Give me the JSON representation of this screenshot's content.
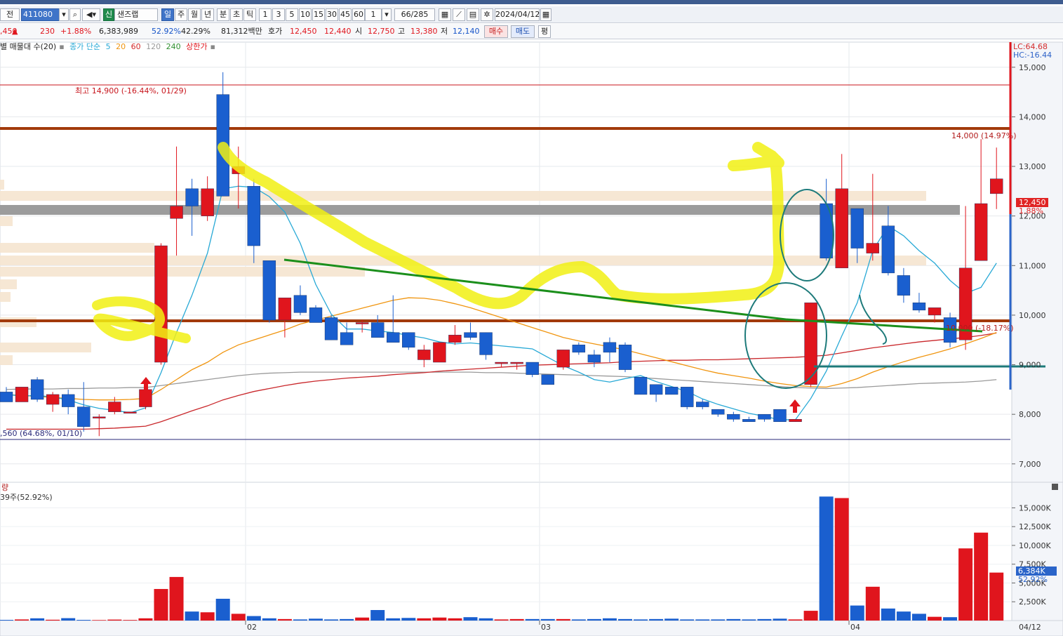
{
  "toolbar": {
    "prev_label": "전",
    "code_value": "411080",
    "sin_badge": "신",
    "stock_name": "샌즈랩",
    "periods": [
      "일",
      "주",
      "월",
      "년",
      "분",
      "초",
      "틱"
    ],
    "intervals": [
      "1",
      "3",
      "5",
      "10",
      "15",
      "30",
      "45",
      "60"
    ],
    "count_value": "1",
    "page_counter": "66/285",
    "date_value": "2024/04/12"
  },
  "quote": {
    "prefix": ",450",
    "arrow": "▲",
    "change": "230",
    "change_pct": "+1.88%",
    "volume": "6,383,989",
    "vol_ratio": "52.92%",
    "turnover_pct": "42.29%",
    "amount": "81,312백만",
    "hoga_label": "호가",
    "ask": "12,450",
    "bid": "12,440",
    "open_label": "시",
    "open": "12,750",
    "high_label": "고",
    "high": "13,380",
    "low_label": "저",
    "low": "12,140",
    "buy_label": "매수",
    "sell_label": "매도",
    "eval_label": "평"
  },
  "legend": {
    "volume_profile": "별 매물대 수(20)",
    "ma_title": "종가 단순",
    "ma_periods": [
      "5",
      "20",
      "60",
      "120",
      "240"
    ],
    "ma_colors": [
      "#28a9d6",
      "#f0950f",
      "#d32a2a",
      "#9a9a9a",
      "#2f8f2f"
    ],
    "limit_label": "상한가"
  },
  "price_panel": {
    "lc_label": "LC:64.68",
    "hc_label": "HC:-16.44",
    "high_annotation": "최고 14,900 (-16.44%, 01/29)",
    "low_annotation": ",560 (64.68%, 01/10)",
    "level_annotation": "10,000 (-18.17%)",
    "top_annotation": "14,000 (14.97%)",
    "current_price": "12,450",
    "current_pct": "1.88%",
    "y_ticks": [
      "15,000",
      "14,000",
      "13,000",
      "12,000",
      "11,000",
      "10,000",
      "9,000",
      "8,000",
      "7,000"
    ]
  },
  "volume_panel": {
    "header_label": "량",
    "sub_label": "39주(52.92%)",
    "y_ticks": [
      "15,000K",
      "12,500K",
      "10,000K",
      "7,500K",
      "5,000K",
      "2,500K"
    ],
    "current_volume": "6,384K",
    "current_pct": "52.92%"
  },
  "x_axis": {
    "month_labels": [
      "02",
      "03",
      "04"
    ],
    "last_date": "04/12"
  },
  "chart_data": {
    "type": "candlestick",
    "candles": [
      {
        "o": 8450,
        "h": 8550,
        "l": 8250,
        "c": 8250
      },
      {
        "o": 8250,
        "h": 8550,
        "l": 8250,
        "c": 8550
      },
      {
        "o": 8700,
        "h": 8750,
        "l": 8250,
        "c": 8300
      },
      {
        "o": 8200,
        "h": 8450,
        "l": 8050,
        "c": 8400
      },
      {
        "o": 8400,
        "h": 8500,
        "l": 8000,
        "c": 8150
      },
      {
        "o": 8150,
        "h": 8650,
        "l": 7650,
        "c": 7750
      },
      {
        "o": 7950,
        "h": 8000,
        "l": 7560,
        "c": 7950
      },
      {
        "o": 8050,
        "h": 8350,
        "l": 8000,
        "c": 8250
      },
      {
        "o": 8050,
        "h": 8050,
        "l": 8050,
        "c": 8050
      },
      {
        "o": 8150,
        "h": 8550,
        "l": 8100,
        "c": 8500
      },
      {
        "o": 9050,
        "h": 11450,
        "l": 9000,
        "c": 11400
      },
      {
        "o": 11950,
        "h": 13400,
        "l": 11200,
        "c": 12200
      },
      {
        "o": 12550,
        "h": 12750,
        "l": 11600,
        "c": 12200
      },
      {
        "o": 12000,
        "h": 12800,
        "l": 11900,
        "c": 12550
      },
      {
        "o": 14450,
        "h": 14900,
        "l": 12400,
        "c": 12400
      },
      {
        "o": 12850,
        "h": 13400,
        "l": 12150,
        "c": 13000
      },
      {
        "o": 12600,
        "h": 12750,
        "l": 11050,
        "c": 11400
      },
      {
        "o": 11100,
        "h": 11100,
        "l": 9850,
        "c": 9900
      },
      {
        "o": 9900,
        "h": 10350,
        "l": 9550,
        "c": 10350
      },
      {
        "o": 10400,
        "h": 10600,
        "l": 10000,
        "c": 10050
      },
      {
        "o": 10150,
        "h": 10200,
        "l": 9850,
        "c": 9850
      },
      {
        "o": 9950,
        "h": 10000,
        "l": 9500,
        "c": 9500
      },
      {
        "o": 9650,
        "h": 9850,
        "l": 9400,
        "c": 9400
      },
      {
        "o": 9850,
        "h": 9900,
        "l": 9650,
        "c": 9850
      },
      {
        "o": 9850,
        "h": 10000,
        "l": 9550,
        "c": 9550
      },
      {
        "o": 9650,
        "h": 10400,
        "l": 9500,
        "c": 9450
      },
      {
        "o": 9650,
        "h": 9650,
        "l": 9300,
        "c": 9350
      },
      {
        "o": 9100,
        "h": 9400,
        "l": 8950,
        "c": 9300
      },
      {
        "o": 9050,
        "h": 9450,
        "l": 9050,
        "c": 9450
      },
      {
        "o": 9450,
        "h": 9800,
        "l": 9400,
        "c": 9600
      },
      {
        "o": 9650,
        "h": 9850,
        "l": 9500,
        "c": 9550
      },
      {
        "o": 9650,
        "h": 9650,
        "l": 9100,
        "c": 9200
      },
      {
        "o": 9050,
        "h": 9050,
        "l": 8950,
        "c": 9050
      },
      {
        "o": 9050,
        "h": 9050,
        "l": 8900,
        "c": 9050
      },
      {
        "o": 9050,
        "h": 9050,
        "l": 8750,
        "c": 8800
      },
      {
        "o": 8800,
        "h": 8800,
        "l": 8600,
        "c": 8600
      },
      {
        "o": 8950,
        "h": 9300,
        "l": 8900,
        "c": 9300
      },
      {
        "o": 9400,
        "h": 9450,
        "l": 9200,
        "c": 9250
      },
      {
        "o": 9200,
        "h": 9300,
        "l": 8950,
        "c": 9050
      },
      {
        "o": 9450,
        "h": 9550,
        "l": 9050,
        "c": 9250
      },
      {
        "o": 9400,
        "h": 9450,
        "l": 8850,
        "c": 8900
      },
      {
        "o": 8750,
        "h": 8750,
        "l": 8400,
        "c": 8400
      },
      {
        "o": 8600,
        "h": 8600,
        "l": 8250,
        "c": 8400
      },
      {
        "o": 8550,
        "h": 8550,
        "l": 8400,
        "c": 8400
      },
      {
        "o": 8550,
        "h": 8550,
        "l": 8100,
        "c": 8150
      },
      {
        "o": 8250,
        "h": 8300,
        "l": 8100,
        "c": 8150
      },
      {
        "o": 8100,
        "h": 8100,
        "l": 7950,
        "c": 8000
      },
      {
        "o": 8000,
        "h": 8050,
        "l": 7850,
        "c": 7900
      },
      {
        "o": 7900,
        "h": 7950,
        "l": 7850,
        "c": 7850
      },
      {
        "o": 8000,
        "h": 8000,
        "l": 7850,
        "c": 7900
      },
      {
        "o": 8100,
        "h": 8100,
        "l": 7850,
        "c": 7850
      },
      {
        "o": 7850,
        "h": 7900,
        "l": 7850,
        "c": 7900
      },
      {
        "o": 8600,
        "h": 10250,
        "l": 8550,
        "c": 10250
      },
      {
        "o": 12250,
        "h": 12750,
        "l": 11100,
        "c": 11150
      },
      {
        "o": 10950,
        "h": 13250,
        "l": 10950,
        "c": 12550
      },
      {
        "o": 12150,
        "h": 12150,
        "l": 11050,
        "c": 11350
      },
      {
        "o": 11250,
        "h": 12850,
        "l": 11100,
        "c": 11450
      },
      {
        "o": 11800,
        "h": 12200,
        "l": 10800,
        "c": 10850
      },
      {
        "o": 10800,
        "h": 10950,
        "l": 10250,
        "c": 10400
      },
      {
        "o": 10250,
        "h": 10450,
        "l": 10050,
        "c": 10100
      },
      {
        "o": 10000,
        "h": 10100,
        "l": 9850,
        "c": 10150
      },
      {
        "o": 9950,
        "h": 10050,
        "l": 9350,
        "c": 9450
      },
      {
        "o": 9500,
        "h": 12200,
        "l": 9300,
        "c": 10950
      },
      {
        "o": 11100,
        "h": 13550,
        "l": 11100,
        "c": 12250
      },
      {
        "o": 12450,
        "h": 13380,
        "l": 12140,
        "c": 12750
      }
    ],
    "ma5": [
      8400,
      8370,
      8380,
      8350,
      8290,
      8190,
      8120,
      8080,
      8030,
      8130,
      8840,
      9650,
      10400,
      11250,
      12550,
      12600,
      12580,
      12390,
      12080,
      11450,
      10620,
      10020,
      9720,
      9720,
      9680,
      9650,
      9590,
      9540,
      9460,
      9420,
      9440,
      9410,
      9380,
      9350,
      9320,
      9150,
      8980,
      8850,
      8700,
      8650,
      8720,
      8780,
      8660,
      8560,
      8460,
      8310,
      8200,
      8110,
      8020,
      7960,
      7890,
      7890,
      8320,
      8870,
      9580,
      10250,
      11300,
      11800,
      11600,
      11300,
      11050,
      10700,
      10440,
      10560,
      11050
    ],
    "ma20": [
      8400,
      8380,
      8360,
      8340,
      8320,
      8300,
      8290,
      8290,
      8300,
      8320,
      8500,
      8700,
      8900,
      9050,
      9250,
      9400,
      9500,
      9600,
      9700,
      9820,
      9900,
      9980,
      10060,
      10140,
      10220,
      10300,
      10350,
      10340,
      10300,
      10230,
      10150,
      10050,
      9950,
      9850,
      9750,
      9650,
      9550,
      9480,
      9420,
      9360,
      9300,
      9220,
      9140,
      9060,
      8980,
      8900,
      8830,
      8780,
      8730,
      8670,
      8620,
      8580,
      8560,
      8550,
      8620,
      8720,
      8850,
      8960,
      9060,
      9150,
      9230,
      9320,
      9420,
      9530,
      9650
    ],
    "ma60": [
      7700,
      7700,
      7700,
      7700,
      7700,
      7700,
      7710,
      7720,
      7740,
      7760,
      7850,
      7960,
      8070,
      8170,
      8290,
      8380,
      8460,
      8520,
      8580,
      8630,
      8670,
      8700,
      8730,
      8750,
      8770,
      8800,
      8820,
      8840,
      8870,
      8890,
      8910,
      8930,
      8950,
      8970,
      8990,
      9000,
      9010,
      9020,
      9030,
      9040,
      9060,
      9070,
      9080,
      9090,
      9090,
      9100,
      9100,
      9110,
      9120,
      9130,
      9140,
      9150,
      9170,
      9190,
      9240,
      9290,
      9340,
      9380,
      9420,
      9460,
      9490,
      9520,
      9550,
      9590,
      9640
    ],
    "ma120": [
      8500,
      8510,
      8510,
      8510,
      8520,
      8520,
      8530,
      8530,
      8540,
      8540,
      8580,
      8620,
      8660,
      8700,
      8740,
      8780,
      8810,
      8830,
      8840,
      8850,
      8850,
      8850,
      8850,
      8850,
      8850,
      8850,
      8850,
      8850,
      8850,
      8850,
      8850,
      8840,
      8840,
      8830,
      8820,
      8810,
      8800,
      8790,
      8780,
      8770,
      8760,
      8740,
      8720,
      8700,
      8680,
      8660,
      8640,
      8620,
      8600,
      8580,
      8560,
      8540,
      8530,
      8520,
      8530,
      8540,
      8560,
      8580,
      8600,
      8620,
      8630,
      8640,
      8650,
      8670,
      8700
    ],
    "volume_k": [
      90,
      150,
      300,
      110,
      320,
      90,
      70,
      130,
      80,
      300,
      4200,
      5800,
      1200,
      1100,
      2900,
      900,
      600,
      300,
      200,
      150,
      250,
      150,
      200,
      400,
      1400,
      300,
      350,
      300,
      400,
      300,
      450,
      300,
      150,
      200,
      200,
      200,
      200,
      150,
      200,
      300,
      200,
      150,
      200,
      250,
      150,
      150,
      150,
      200,
      150,
      200,
      250,
      150,
      1300,
      16500,
      16300,
      2000,
      4500,
      1600,
      1200,
      900,
      500,
      450,
      9600,
      11700,
      6384
    ],
    "y_range": [
      6700,
      15450
    ],
    "volume_range": [
      0,
      17000
    ]
  }
}
